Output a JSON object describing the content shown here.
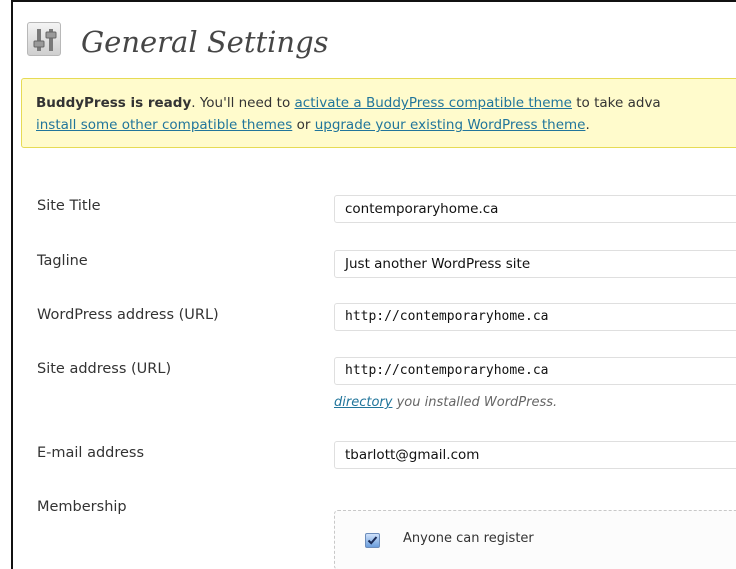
{
  "header": {
    "title": "General Settings",
    "icon": "settings-sliders-icon"
  },
  "notice": {
    "bold_text": "BuddyPress is ready",
    "text_1": ". You'll need to ",
    "link_1": "activate a BuddyPress compatible theme",
    "text_2": " to take adva",
    "link_2": "install some other compatible themes",
    "text_3": " or ",
    "link_3": "upgrade your existing WordPress theme",
    "text_4": "."
  },
  "form": {
    "site_title": {
      "label": "Site Title",
      "value": "contemporaryhome.ca"
    },
    "tagline": {
      "label": "Tagline",
      "value": "Just another WordPress site"
    },
    "wp_address": {
      "label": "WordPress address (URL)",
      "value": "http://contemporaryhome.ca"
    },
    "site_address": {
      "label": "Site address (URL)",
      "value": "http://contemporaryhome.ca",
      "hint_link": "directory",
      "hint_text": " you installed WordPress."
    },
    "email": {
      "label": "E-mail address",
      "value": "tbarlott@gmail.com"
    },
    "membership": {
      "label": "Membership",
      "checkbox_label": "Anyone can register",
      "checked": true
    }
  },
  "colors": {
    "link": "#21759b",
    "notice_bg": "#fffbcc",
    "notice_border": "#e6db55"
  }
}
